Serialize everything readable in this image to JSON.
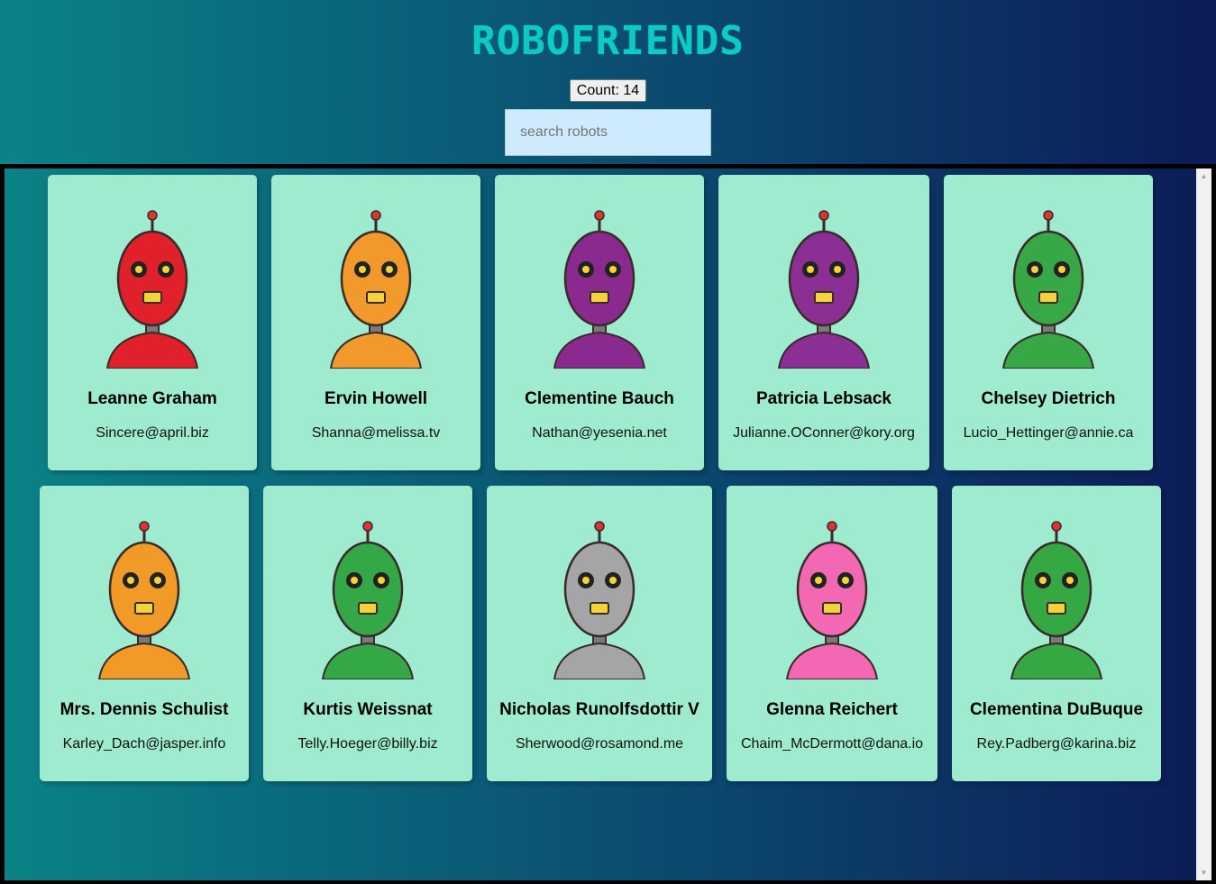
{
  "app": {
    "title": "ROBOFRIENDS",
    "count_label": "Count: 14",
    "search_placeholder": "search robots"
  },
  "robots": [
    {
      "name": "Leanne Graham",
      "email": "Sincere@april.biz",
      "color": "#e0202a"
    },
    {
      "name": "Ervin Howell",
      "email": "Shanna@melissa.tv",
      "color": "#f19a2b"
    },
    {
      "name": "Clementine Bauch",
      "email": "Nathan@yesenia.net",
      "color": "#8a2a8e"
    },
    {
      "name": "Patricia Lebsack",
      "email": "Julianne.OConner@kory.org",
      "color": "#8c2f94"
    },
    {
      "name": "Chelsey Dietrich",
      "email": "Lucio_Hettinger@annie.ca",
      "color": "#37a845"
    },
    {
      "name": "Mrs. Dennis Schulist",
      "email": "Karley_Dach@jasper.info",
      "color": "#f29a28"
    },
    {
      "name": "Kurtis Weissnat",
      "email": "Telly.Hoeger@billy.biz",
      "color": "#34a846"
    },
    {
      "name": "Nicholas Runolfsdottir V",
      "email": "Sherwood@rosamond.me",
      "color": "#a5a5a8"
    },
    {
      "name": "Glenna Reichert",
      "email": "Chaim_McDermott@dana.io",
      "color": "#f268b3"
    },
    {
      "name": "Clementina DuBuque",
      "email": "Rey.Padberg@karina.biz",
      "color": "#35a844"
    }
  ]
}
